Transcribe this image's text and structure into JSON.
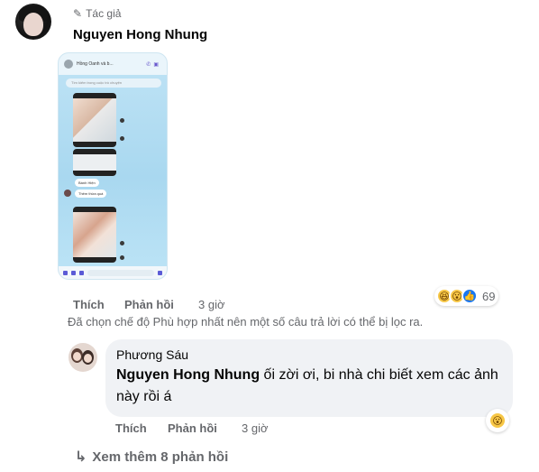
{
  "comment": {
    "badge_icon": "pencil-icon",
    "badge_label": "Tác giả",
    "author": "Nguyen Hong Nhung",
    "attachment": {
      "header_title": "Hồng Oanh và b...",
      "search_placeholder": "Tìm kiếm trong cuộc trò chuyện",
      "bubble_1": "Bánh Hiện",
      "bubble_2": "Thêm thừa quá"
    },
    "actions": {
      "like": "Thích",
      "reply": "Phản hồi",
      "time": "3 giờ"
    },
    "reactions": {
      "icons": [
        "haha-icon",
        "wow-icon",
        "like-icon"
      ],
      "count": "69"
    },
    "filter_note": "Đã chọn chế độ Phù hợp nhất nên một số câu trả lời có thể bị lọc ra."
  },
  "reply": {
    "author": "Phương Sáu",
    "mention": "Nguyen Hong Nhung",
    "text": " ối zời ơi, bi nhà chi biết xem các ảnh này rồi á",
    "actions": {
      "like": "Thích",
      "reply": "Phản hồi",
      "time": "3 giờ"
    },
    "reaction": "wow-icon"
  },
  "more_replies": "Xem thêm 8 phản hồi"
}
